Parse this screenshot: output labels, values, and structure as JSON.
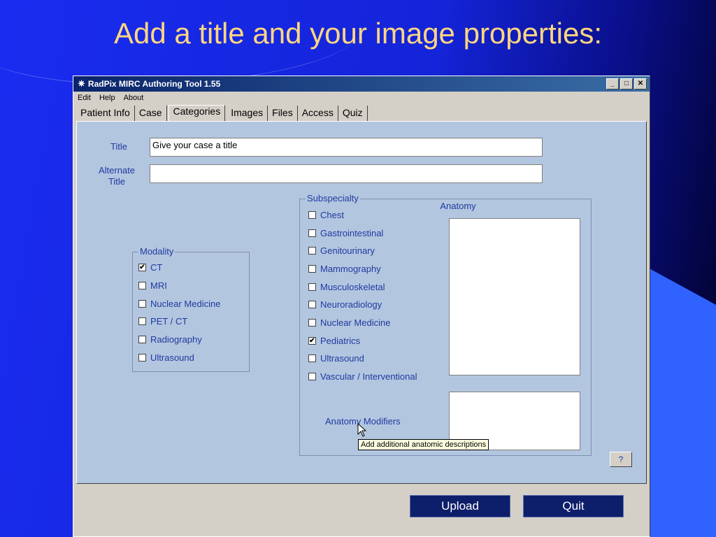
{
  "slide": {
    "title": "Add a title and your image properties:"
  },
  "window": {
    "title": "RadPix MIRC Authoring Tool 1.55",
    "controls": {
      "minimize": "_",
      "maximize": "□",
      "close": "✕"
    },
    "menu": [
      "Edit",
      "Help",
      "About"
    ],
    "tabs": [
      {
        "label": "Patient Info",
        "active": false
      },
      {
        "label": "Case",
        "active": false
      },
      {
        "label": "Categories",
        "active": true
      },
      {
        "label": "Images",
        "active": false
      },
      {
        "label": "Files",
        "active": false
      },
      {
        "label": "Access",
        "active": false
      },
      {
        "label": "Quiz",
        "active": false
      }
    ]
  },
  "form": {
    "title_label": "Title",
    "title_value": "Give your case a title",
    "alt_title_label": "Alternate Title",
    "alt_title_value": "",
    "modality": {
      "legend": "Modality",
      "items": [
        {
          "label": "CT",
          "checked": true
        },
        {
          "label": "MRI",
          "checked": false
        },
        {
          "label": "Nuclear Medicine",
          "checked": false
        },
        {
          "label": "PET / CT",
          "checked": false
        },
        {
          "label": "Radiography",
          "checked": false
        },
        {
          "label": "Ultrasound",
          "checked": false
        }
      ]
    },
    "subspecialty": {
      "legend": "Subspecialty",
      "items": [
        {
          "label": "Chest",
          "checked": false
        },
        {
          "label": "Gastrointestinal",
          "checked": false
        },
        {
          "label": "Genitourinary",
          "checked": false
        },
        {
          "label": "Mammography",
          "checked": false
        },
        {
          "label": "Musculoskeletal",
          "checked": false
        },
        {
          "label": "Neuroradiology",
          "checked": false
        },
        {
          "label": "Nuclear Medicine",
          "checked": false
        },
        {
          "label": "Pediatrics",
          "checked": true
        },
        {
          "label": "Ultrasound",
          "checked": false
        },
        {
          "label": "Vascular / Interventional",
          "checked": false
        }
      ]
    },
    "anatomy_label": "Anatomy",
    "anatomy_modifiers_label": "Anatomy Modifiers",
    "tooltip": "Add additional anatomic descriptions",
    "help_label": "?"
  },
  "buttons": {
    "upload": "Upload",
    "quit": "Quit"
  },
  "colors": {
    "slide_title": "#ffd680",
    "label_blue": "#1f3a9e",
    "panel_bg": "#b3c6e0",
    "button_navy": "#0d1e6a"
  }
}
